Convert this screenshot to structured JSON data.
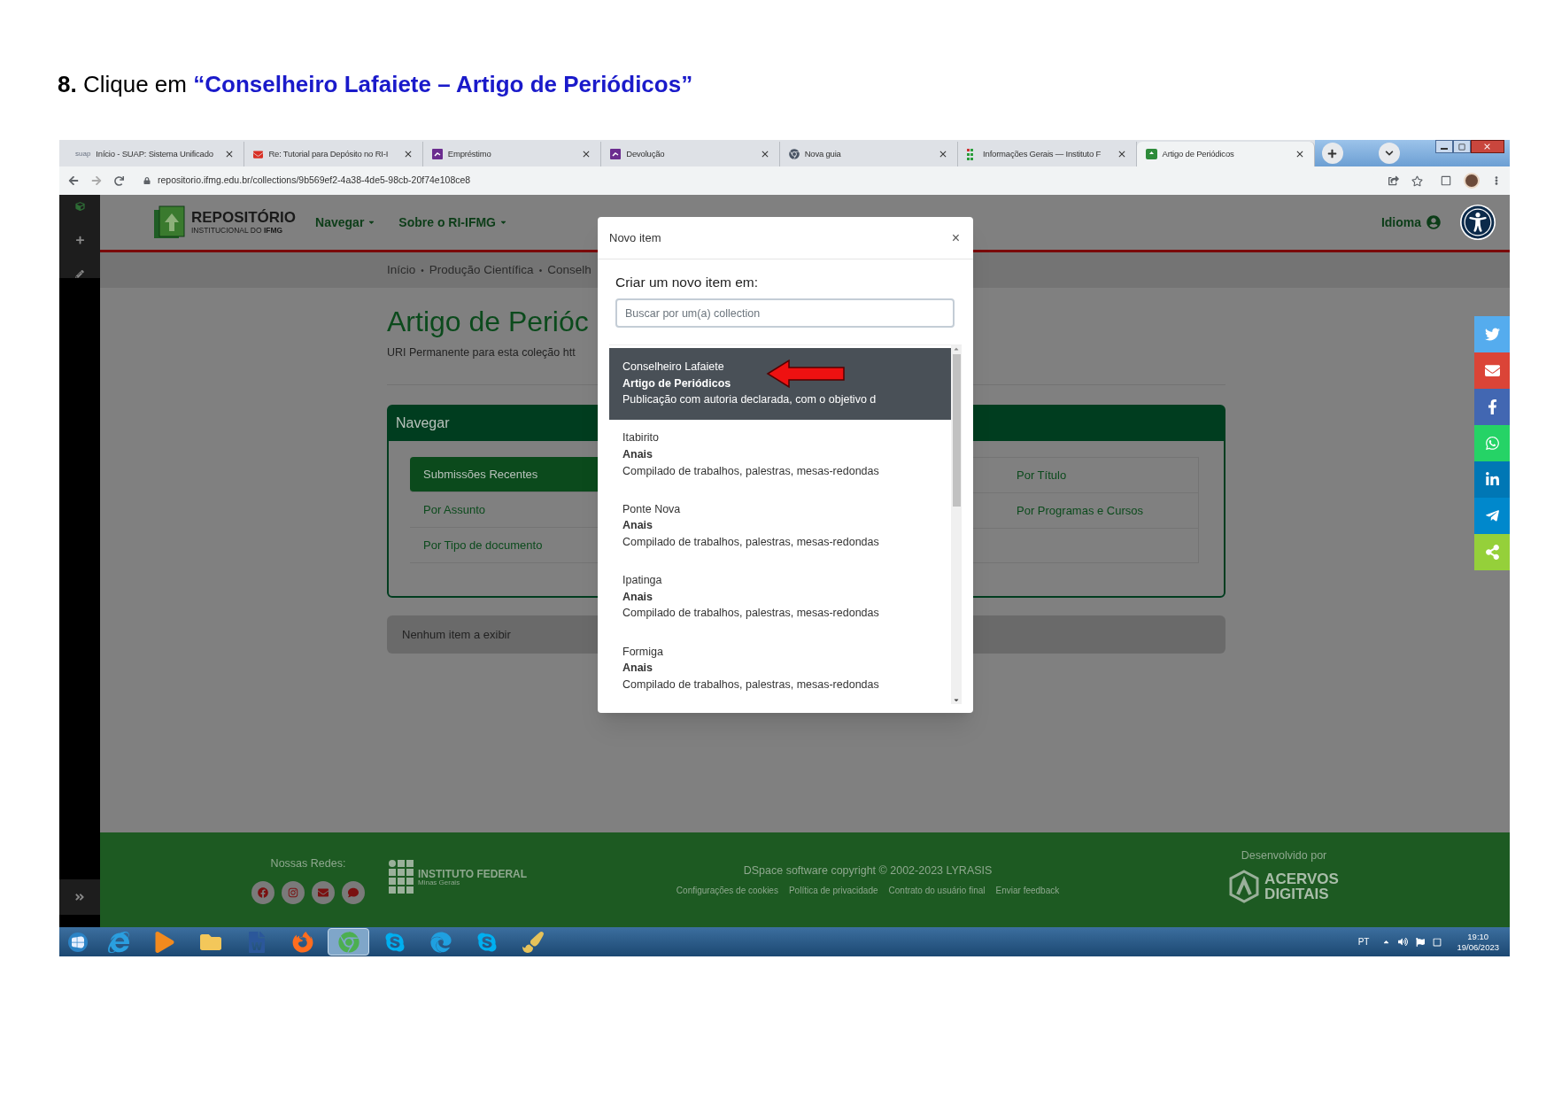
{
  "heading": {
    "number": "8.",
    "text": "Clique em",
    "target": "“Conselheiro Lafaiete – Artigo de Periódicos”"
  },
  "browser": {
    "tabs": [
      {
        "title": "Início - SUAP: Sistema Unificado",
        "kind": "text",
        "favicon_text": "suap",
        "selected": false
      },
      {
        "title": "Re: Tutorial para Depósito no RI-I",
        "kind": "mail",
        "selected": false
      },
      {
        "title": "Empréstimo",
        "kind": "purple",
        "selected": false
      },
      {
        "title": "Devolução",
        "kind": "purple",
        "selected": false
      },
      {
        "title": "Nova guia",
        "kind": "chrome",
        "selected": false
      },
      {
        "title": "Informações Gerais — Instituto F",
        "kind": "grid",
        "selected": false
      },
      {
        "title": "Artigo de Periódicos",
        "kind": "repo",
        "selected": true
      }
    ],
    "url": "repositorio.ifmg.edu.br/collections/9b569ef2-4a38-4de5-98cb-20f74e108ce8"
  },
  "site": {
    "logo_title": "REPOSITÓRIO",
    "logo_subtitle": "INSTITUCIONAL DO",
    "logo_subtitle_bold": "IFMG",
    "menu": [
      "Navegar",
      "Sobre o RI-IFMG"
    ],
    "language": "Idioma",
    "breadcrumb": [
      "Início",
      "Produção Científica",
      "Conselh"
    ],
    "breadcrumb_separator": "•",
    "title": "Artigo de Perióc",
    "uri_line": "URI Permanente para esta coleção htt",
    "browse_panel": {
      "title": "Navegar",
      "left": [
        {
          "label": "Submissões Recentes",
          "selected": true
        },
        {
          "label": "Por Assunto",
          "selected": false
        },
        {
          "label": "Por Tipo de documento",
          "selected": false
        }
      ],
      "right": [
        {
          "label": "Por Título",
          "selected": false
        },
        {
          "label": "Por Programas e Cursos",
          "selected": false
        }
      ]
    },
    "empty_notice": "Nenhum item a exibir",
    "footer": {
      "networks_label": "Nossas Redes:",
      "institute": "INSTITUTO FEDERAL",
      "institute_sub": "Minas Gerais",
      "copyright": "DSpace software copyright © 2002-2023 LYRASIS",
      "links": [
        "Configurações de cookies",
        "Política de privacidade",
        "Contrato do usuário final",
        "Enviar feedback"
      ],
      "developed_by": "Desenvolvido por",
      "dev_logo_1": "ACERVOS",
      "dev_logo_2": "DIGITAIS"
    }
  },
  "modal": {
    "title": "Novo item",
    "close": "×",
    "prompt": "Criar um novo item em:",
    "search": {
      "placeholder": "Buscar por um(a) collection"
    },
    "items": [
      {
        "campus": "Conselheiro Lafaiete",
        "name": "Artigo de Periódicos",
        "description": "Publicação com autoria declarada, com o objetivo d",
        "selected": true
      },
      {
        "campus": "Itabirito",
        "name": "Anais",
        "description": "Compilado de trabalhos, palestras, mesas-redondas",
        "selected": false
      },
      {
        "campus": "Ponte Nova",
        "name": "Anais",
        "description": "Compilado de trabalhos, palestras, mesas-redondas",
        "selected": false
      },
      {
        "campus": "Ipatinga",
        "name": "Anais",
        "description": "Compilado de trabalhos, palestras, mesas-redondas",
        "selected": false
      },
      {
        "campus": "Formiga",
        "name": "Anais",
        "description": "Compilado de trabalhos, palestras, mesas-redondas",
        "selected": false
      }
    ]
  },
  "social": [
    {
      "kind": "twitter",
      "color": "#55acee"
    },
    {
      "kind": "mail",
      "color": "#db4437"
    },
    {
      "kind": "facebook",
      "color": "#4267b2"
    },
    {
      "kind": "whatsapp",
      "color": "#25d366"
    },
    {
      "kind": "linkedin",
      "color": "#0077b5"
    },
    {
      "kind": "telegram",
      "color": "#0088cc"
    },
    {
      "kind": "share",
      "color": "#95d03a"
    }
  ],
  "taskbar": {
    "apps": [
      {
        "kind": "ie",
        "selected": false
      },
      {
        "kind": "media",
        "selected": false
      },
      {
        "kind": "folder",
        "selected": false
      },
      {
        "kind": "word",
        "selected": false
      },
      {
        "kind": "firefox",
        "selected": false
      },
      {
        "kind": "chrome",
        "selected": true
      },
      {
        "kind": "skype",
        "selected": false
      },
      {
        "kind": "edge",
        "selected": false
      },
      {
        "kind": "skype",
        "selected": false
      },
      {
        "kind": "paint",
        "selected": false
      }
    ],
    "language": "PT",
    "time": "19:10",
    "date": "19/06/2023"
  }
}
